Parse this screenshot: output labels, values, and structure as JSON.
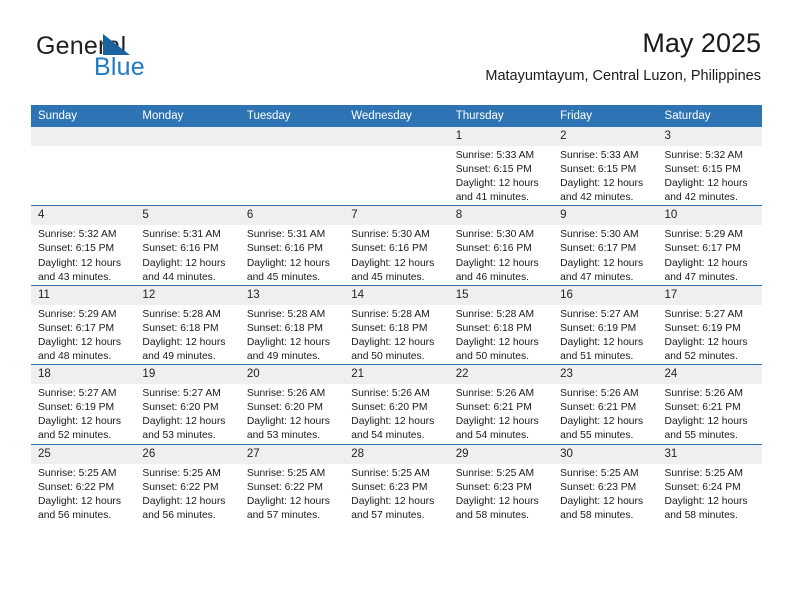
{
  "brand": {
    "name_top": "General",
    "name_bottom": "Blue",
    "triangle_icon": "brand-triangle-icon",
    "accent_color": "#1f7ac4"
  },
  "header": {
    "title": "May 2025",
    "subtitle": "Matayumtayum, Central Luzon, Philippines"
  },
  "theme": {
    "header_blue": "#2e74b5",
    "daynum_bg": "#efefef",
    "text": "#1a1a1a"
  },
  "weekday_headers": [
    "Sunday",
    "Monday",
    "Tuesday",
    "Wednesday",
    "Thursday",
    "Friday",
    "Saturday"
  ],
  "weeks": [
    [
      {
        "day": "",
        "sunrise": "",
        "sunset": "",
        "daylight": ""
      },
      {
        "day": "",
        "sunrise": "",
        "sunset": "",
        "daylight": ""
      },
      {
        "day": "",
        "sunrise": "",
        "sunset": "",
        "daylight": ""
      },
      {
        "day": "",
        "sunrise": "",
        "sunset": "",
        "daylight": ""
      },
      {
        "day": "1",
        "sunrise": "Sunrise: 5:33 AM",
        "sunset": "Sunset: 6:15 PM",
        "daylight": "Daylight: 12 hours and 41 minutes."
      },
      {
        "day": "2",
        "sunrise": "Sunrise: 5:33 AM",
        "sunset": "Sunset: 6:15 PM",
        "daylight": "Daylight: 12 hours and 42 minutes."
      },
      {
        "day": "3",
        "sunrise": "Sunrise: 5:32 AM",
        "sunset": "Sunset: 6:15 PM",
        "daylight": "Daylight: 12 hours and 42 minutes."
      }
    ],
    [
      {
        "day": "4",
        "sunrise": "Sunrise: 5:32 AM",
        "sunset": "Sunset: 6:15 PM",
        "daylight": "Daylight: 12 hours and 43 minutes."
      },
      {
        "day": "5",
        "sunrise": "Sunrise: 5:31 AM",
        "sunset": "Sunset: 6:16 PM",
        "daylight": "Daylight: 12 hours and 44 minutes."
      },
      {
        "day": "6",
        "sunrise": "Sunrise: 5:31 AM",
        "sunset": "Sunset: 6:16 PM",
        "daylight": "Daylight: 12 hours and 45 minutes."
      },
      {
        "day": "7",
        "sunrise": "Sunrise: 5:30 AM",
        "sunset": "Sunset: 6:16 PM",
        "daylight": "Daylight: 12 hours and 45 minutes."
      },
      {
        "day": "8",
        "sunrise": "Sunrise: 5:30 AM",
        "sunset": "Sunset: 6:16 PM",
        "daylight": "Daylight: 12 hours and 46 minutes."
      },
      {
        "day": "9",
        "sunrise": "Sunrise: 5:30 AM",
        "sunset": "Sunset: 6:17 PM",
        "daylight": "Daylight: 12 hours and 47 minutes."
      },
      {
        "day": "10",
        "sunrise": "Sunrise: 5:29 AM",
        "sunset": "Sunset: 6:17 PM",
        "daylight": "Daylight: 12 hours and 47 minutes."
      }
    ],
    [
      {
        "day": "11",
        "sunrise": "Sunrise: 5:29 AM",
        "sunset": "Sunset: 6:17 PM",
        "daylight": "Daylight: 12 hours and 48 minutes."
      },
      {
        "day": "12",
        "sunrise": "Sunrise: 5:28 AM",
        "sunset": "Sunset: 6:18 PM",
        "daylight": "Daylight: 12 hours and 49 minutes."
      },
      {
        "day": "13",
        "sunrise": "Sunrise: 5:28 AM",
        "sunset": "Sunset: 6:18 PM",
        "daylight": "Daylight: 12 hours and 49 minutes."
      },
      {
        "day": "14",
        "sunrise": "Sunrise: 5:28 AM",
        "sunset": "Sunset: 6:18 PM",
        "daylight": "Daylight: 12 hours and 50 minutes."
      },
      {
        "day": "15",
        "sunrise": "Sunrise: 5:28 AM",
        "sunset": "Sunset: 6:18 PM",
        "daylight": "Daylight: 12 hours and 50 minutes."
      },
      {
        "day": "16",
        "sunrise": "Sunrise: 5:27 AM",
        "sunset": "Sunset: 6:19 PM",
        "daylight": "Daylight: 12 hours and 51 minutes."
      },
      {
        "day": "17",
        "sunrise": "Sunrise: 5:27 AM",
        "sunset": "Sunset: 6:19 PM",
        "daylight": "Daylight: 12 hours and 52 minutes."
      }
    ],
    [
      {
        "day": "18",
        "sunrise": "Sunrise: 5:27 AM",
        "sunset": "Sunset: 6:19 PM",
        "daylight": "Daylight: 12 hours and 52 minutes."
      },
      {
        "day": "19",
        "sunrise": "Sunrise: 5:27 AM",
        "sunset": "Sunset: 6:20 PM",
        "daylight": "Daylight: 12 hours and 53 minutes."
      },
      {
        "day": "20",
        "sunrise": "Sunrise: 5:26 AM",
        "sunset": "Sunset: 6:20 PM",
        "daylight": "Daylight: 12 hours and 53 minutes."
      },
      {
        "day": "21",
        "sunrise": "Sunrise: 5:26 AM",
        "sunset": "Sunset: 6:20 PM",
        "daylight": "Daylight: 12 hours and 54 minutes."
      },
      {
        "day": "22",
        "sunrise": "Sunrise: 5:26 AM",
        "sunset": "Sunset: 6:21 PM",
        "daylight": "Daylight: 12 hours and 54 minutes."
      },
      {
        "day": "23",
        "sunrise": "Sunrise: 5:26 AM",
        "sunset": "Sunset: 6:21 PM",
        "daylight": "Daylight: 12 hours and 55 minutes."
      },
      {
        "day": "24",
        "sunrise": "Sunrise: 5:26 AM",
        "sunset": "Sunset: 6:21 PM",
        "daylight": "Daylight: 12 hours and 55 minutes."
      }
    ],
    [
      {
        "day": "25",
        "sunrise": "Sunrise: 5:25 AM",
        "sunset": "Sunset: 6:22 PM",
        "daylight": "Daylight: 12 hours and 56 minutes."
      },
      {
        "day": "26",
        "sunrise": "Sunrise: 5:25 AM",
        "sunset": "Sunset: 6:22 PM",
        "daylight": "Daylight: 12 hours and 56 minutes."
      },
      {
        "day": "27",
        "sunrise": "Sunrise: 5:25 AM",
        "sunset": "Sunset: 6:22 PM",
        "daylight": "Daylight: 12 hours and 57 minutes."
      },
      {
        "day": "28",
        "sunrise": "Sunrise: 5:25 AM",
        "sunset": "Sunset: 6:23 PM",
        "daylight": "Daylight: 12 hours and 57 minutes."
      },
      {
        "day": "29",
        "sunrise": "Sunrise: 5:25 AM",
        "sunset": "Sunset: 6:23 PM",
        "daylight": "Daylight: 12 hours and 58 minutes."
      },
      {
        "day": "30",
        "sunrise": "Sunrise: 5:25 AM",
        "sunset": "Sunset: 6:23 PM",
        "daylight": "Daylight: 12 hours and 58 minutes."
      },
      {
        "day": "31",
        "sunrise": "Sunrise: 5:25 AM",
        "sunset": "Sunset: 6:24 PM",
        "daylight": "Daylight: 12 hours and 58 minutes."
      }
    ]
  ]
}
